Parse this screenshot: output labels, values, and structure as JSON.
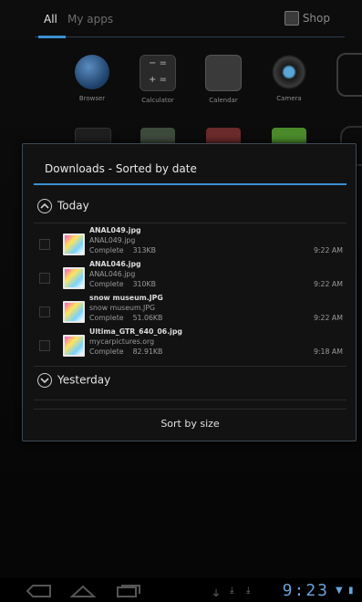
{
  "launcher": {
    "tabs": [
      {
        "label": "All"
      },
      {
        "label": "My apps"
      }
    ],
    "shop_label": "Shop",
    "apps": [
      {
        "label": "Browser",
        "icon": "globe-icon"
      },
      {
        "label": "Calculator",
        "icon": "calculator-icon"
      },
      {
        "label": "Calendar",
        "icon": "calendar-icon"
      },
      {
        "label": "Camera",
        "icon": "camera-icon"
      }
    ]
  },
  "dialog": {
    "title": "Downloads - Sorted by date",
    "groups": {
      "today": "Today",
      "yesterday": "Yesterday"
    },
    "items": [
      {
        "name": "ANAL049.jpg",
        "source": "ANAL049.jpg",
        "status": "Complete",
        "size": "313KB",
        "time": "9:22 AM"
      },
      {
        "name": "ANAL046.jpg",
        "source": "ANAL046.jpg",
        "status": "Complete",
        "size": "310KB",
        "time": "9:22 AM"
      },
      {
        "name": "snow museum.JPG",
        "source": "snow museum.JPG",
        "status": "Complete",
        "size": "51.06KB",
        "time": "9:22 AM"
      },
      {
        "name": "Ultima_GTR_640_06.jpg",
        "source": "mycarpictures.org",
        "status": "Complete",
        "size": "82.91KB",
        "time": "9:18 AM"
      }
    ],
    "sort_button": "Sort by size"
  },
  "statusbar": {
    "clock": "9:23"
  },
  "colors": {
    "accent": "#3a90d0",
    "dialog_bg": "#121212"
  }
}
